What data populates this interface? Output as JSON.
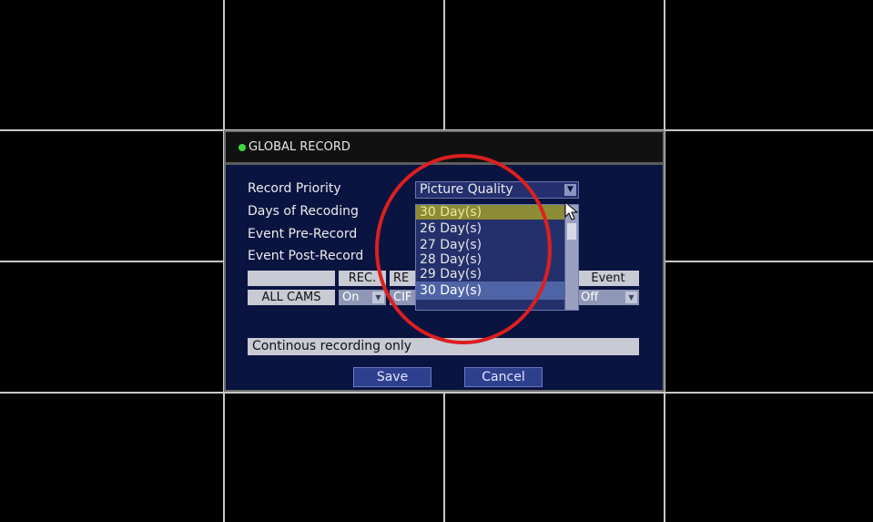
{
  "dialog": {
    "title": "GLOBAL RECORD",
    "indicator_color": "#3cd93c"
  },
  "form": {
    "record_priority_label": "Record Priority",
    "record_priority_value": "Picture Quality",
    "days_label": "Days of Recoding",
    "pre_record_label": "Event Pre-Record",
    "post_record_label": "Event Post-Record"
  },
  "days_dropdown": {
    "selected": "30 Day(s)",
    "options": [
      "26 Day(s)",
      "27 Day(s)",
      "28 Day(s)",
      "29 Day(s)",
      "30 Day(s)"
    ]
  },
  "table": {
    "headers": [
      "",
      "REC.",
      "RE",
      "Event"
    ],
    "row": {
      "camera": "ALL CAMS",
      "rec": "On",
      "res": "CIF",
      "event": "Off"
    }
  },
  "status_text": "Continous recording only",
  "buttons": {
    "save": "Save",
    "cancel": "Cancel"
  },
  "icons": {
    "dropdown": "dropdown-arrow-icon",
    "cursor": "mouse-pointer-icon",
    "status": "status-indicator-icon"
  },
  "colors": {
    "dialog_bg": "#0a1440",
    "button_bg": "#2e3f8e",
    "annotation": "#dc1f1f"
  }
}
